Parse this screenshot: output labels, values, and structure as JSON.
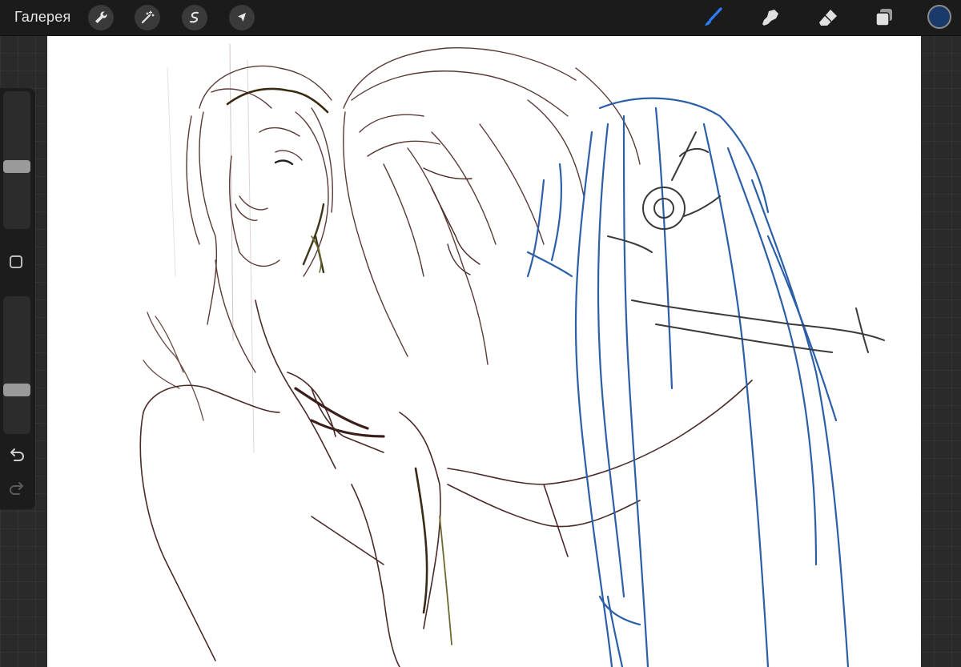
{
  "topbar": {
    "gallery_label": "Галерея",
    "left_tools": [
      {
        "name": "wrench-icon"
      },
      {
        "name": "magic-wand-icon"
      },
      {
        "name": "selection-icon"
      },
      {
        "name": "transform-arrow-icon"
      }
    ],
    "right_tools": [
      {
        "name": "brush-icon",
        "active": true
      },
      {
        "name": "smudge-icon",
        "active": false
      },
      {
        "name": "eraser-icon",
        "active": false
      },
      {
        "name": "layers-icon",
        "active": false
      }
    ],
    "current_color": "#1a3a6b",
    "accent_color": "#2a7fff"
  },
  "sidebar": {
    "brush_size_level": 0.45,
    "opacity_level": 0.3,
    "modify_button": "square-icon",
    "undo_icon": "undo-icon",
    "redo_icon": "redo-icon"
  },
  "canvas": {
    "background": "#ffffff",
    "stroke_colors": {
      "sketch_brown": "#4a2a26",
      "light_brown": "#7a5a55",
      "blue": "#2b5fa8",
      "dark_gray": "#3a3a3a",
      "olive": "#6b6a30"
    }
  }
}
